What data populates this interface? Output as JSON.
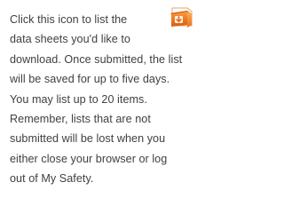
{
  "help_panel": {
    "lines": [
      "Click this icon to list the",
      "data sheets you'd like to",
      "download. Once submitted, the list",
      "will be saved for up to five days.",
      "You may list up to 20 items.",
      "Remember, lists that are not",
      "submitted will be lost when you",
      "either close your browser or log",
      "out of My Safety."
    ],
    "icon": "download-list-icon",
    "icon_color": "#e9701e"
  }
}
